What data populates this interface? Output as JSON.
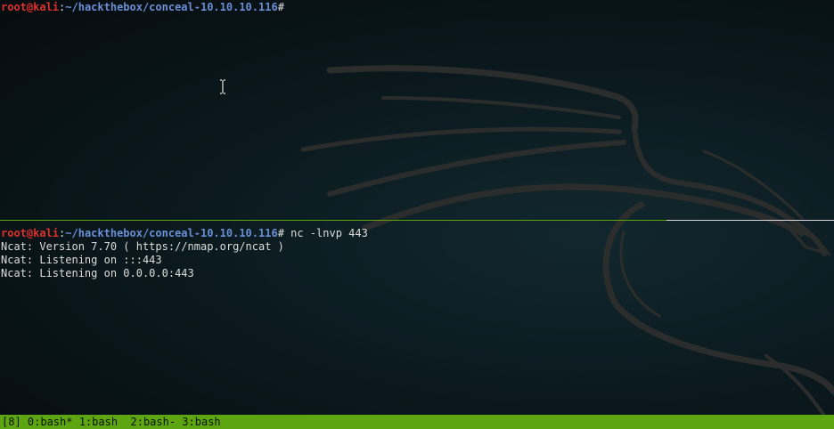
{
  "top_pane": {
    "prompt_user": "root@kali",
    "prompt_sep": ":",
    "prompt_path": "~/hackthebox/conceal-10.10.10.116",
    "prompt_hash": "#"
  },
  "bottom_pane": {
    "prompt_user": "root@kali",
    "prompt_sep": ":",
    "prompt_path": "~/hackthebox/conceal-10.10.10.116",
    "prompt_hash": "#",
    "command": " nc -lnvp 443",
    "output": [
      "Ncat: Version 7.70 ( https://nmap.org/ncat )",
      "Ncat: Listening on :::443",
      "Ncat: Listening on 0.0.0.0:443"
    ]
  },
  "status_bar": {
    "text": "[8] 0:bash* 1:bash  2:bash- 3:bash"
  },
  "colors": {
    "prompt_user": "#e0302b",
    "prompt_path": "#6a8fd6",
    "status_bar": "#5ea512",
    "divider_active": "#5aa10f"
  },
  "icons": {
    "cursor": "text-cursor-icon",
    "wallpaper": "kali-dragon-icon"
  }
}
